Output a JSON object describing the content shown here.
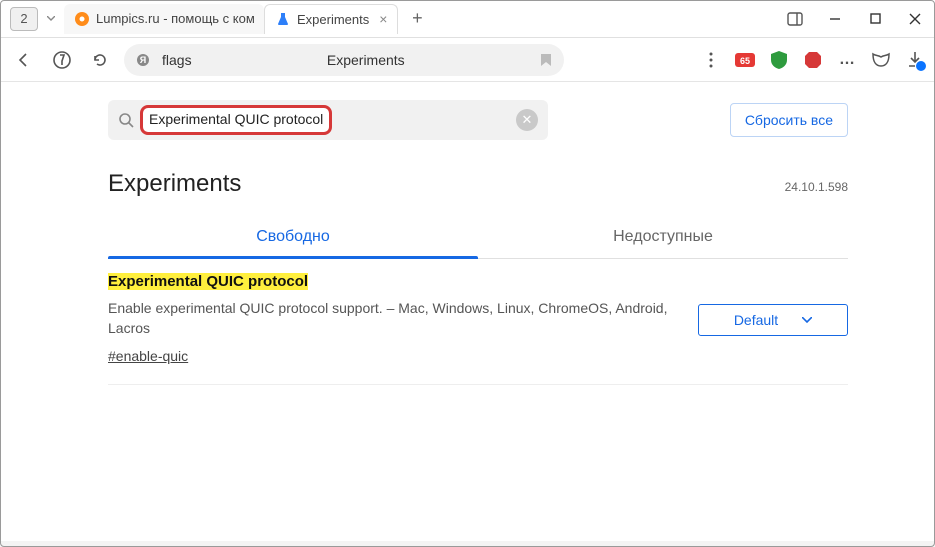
{
  "window": {
    "tab_count": "2",
    "tabs": [
      {
        "label": "Lumpics.ru - помощь с ком",
        "icon_color": "#ff8c1a"
      },
      {
        "label": "Experiments",
        "icon_color": "#2d7ff9"
      }
    ]
  },
  "toolbar": {
    "url_label": "flags",
    "page_label": "Experiments"
  },
  "search": {
    "value": "Experimental QUIC protocol",
    "reset_label": "Сбросить все"
  },
  "page": {
    "title": "Experiments",
    "version": "24.10.1.598"
  },
  "content_tabs": {
    "available": "Свободно",
    "unavailable": "Недоступные"
  },
  "flag": {
    "title": "Experimental QUIC protocol",
    "description": "Enable experimental QUIC protocol support. – Mac, Windows, Linux, ChromeOS, Android, Lacros",
    "hash": "#enable-quic",
    "select_value": "Default"
  }
}
